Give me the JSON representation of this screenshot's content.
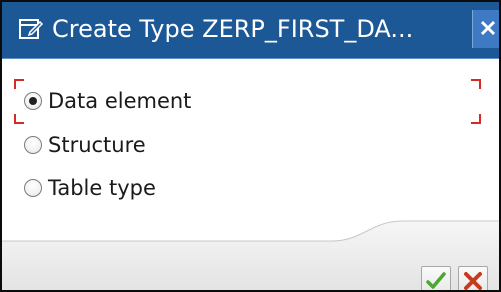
{
  "window": {
    "title": "Create Type ZERP_FIRST_DA...",
    "title_icon": "edit-window-icon",
    "close_icon": "close-icon",
    "colors": {
      "titlebar": "#1d5896",
      "close_button": "#3e79c4",
      "focus_marker": "#d52a2a",
      "ok_check": "#4aa832",
      "cancel_x": "#c63a1e"
    }
  },
  "options": {
    "selected": "Data element",
    "items": [
      {
        "label": "Data element",
        "selected": true
      },
      {
        "label": "Structure",
        "selected": false
      },
      {
        "label": "Table type",
        "selected": false
      }
    ]
  },
  "footer": {
    "ok_icon": "checkmark-icon",
    "cancel_icon": "cancel-x-icon"
  }
}
